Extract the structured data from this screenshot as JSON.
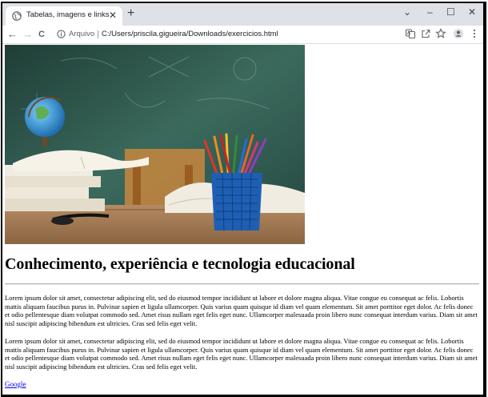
{
  "browser": {
    "tab_title": "Tabelas, imagens e links",
    "tab_close": "✕",
    "new_tab": "+",
    "window_controls": {
      "chevron": "⌄",
      "minimize": "–",
      "maximize": "☐",
      "close": "✕"
    },
    "nav": {
      "back": "←",
      "forward": "→",
      "reload": "C"
    },
    "site_info": "Arquivo",
    "url": "C:/Users/priscila.gigueira/Downloads/exercicios.html",
    "icons": [
      "translate-icon",
      "share-icon",
      "bookmark-star-icon",
      "profile-icon",
      "menu-kebab-icon"
    ]
  },
  "page": {
    "heading": "Conhecimento, experiência e tecnologia educacional",
    "paragraphs": [
      "Lorem ipsum dolor sit amet, consectetur adipiscing elit, sed do eiusmod tempor incididunt ut labore et dolore magna aliqua. Vitae congue eu consequat ac felis. Lobortis mattis aliquam faucibus purus in. Pulvinar sapien et ligula ullamcorper. Quis varius quam quisque id diam vel quam elementum. Sit amet porttitor eget dolor. Ac felis donec et odio pellentesque diam volutpat commodo sed. Amet risus nullam eget felis eget nunc. Ullamcorper malesuada proin libero nunc consequat interdum varius. Diam sit amet nisl suscipit adipiscing bibendum est ultricies. Cras sed felis eget velit.",
      "Lorem ipsum dolor sit amet, consectetur adipiscing elit, sed do eiusmod tempor incididunt ut labore et dolore magna aliqua. Vitae congue eu consequat ac felis. Lobortis mattis aliquam faucibus purus in. Pulvinar sapien et ligula ullamcorper. Quis varius quam quisque id diam vel quam elementum. Sit amet porttitor eget dolor. Ac felis donec et odio pellentesque diam volutpat commodo sed. Amet risus nullam eget felis eget nunc. Ullamcorper malesuada proin libero nunc consequat interdum varius. Diam sit amet nisl suscipit adipiscing bibendum est ultricies. Cras sed felis eget velit."
    ],
    "link_text": "Google"
  },
  "colors": {
    "tabstrip": "#dee1e6",
    "link": "#0000ee",
    "chalkboard": "#2f5a4f",
    "desk": "#a27a55"
  }
}
